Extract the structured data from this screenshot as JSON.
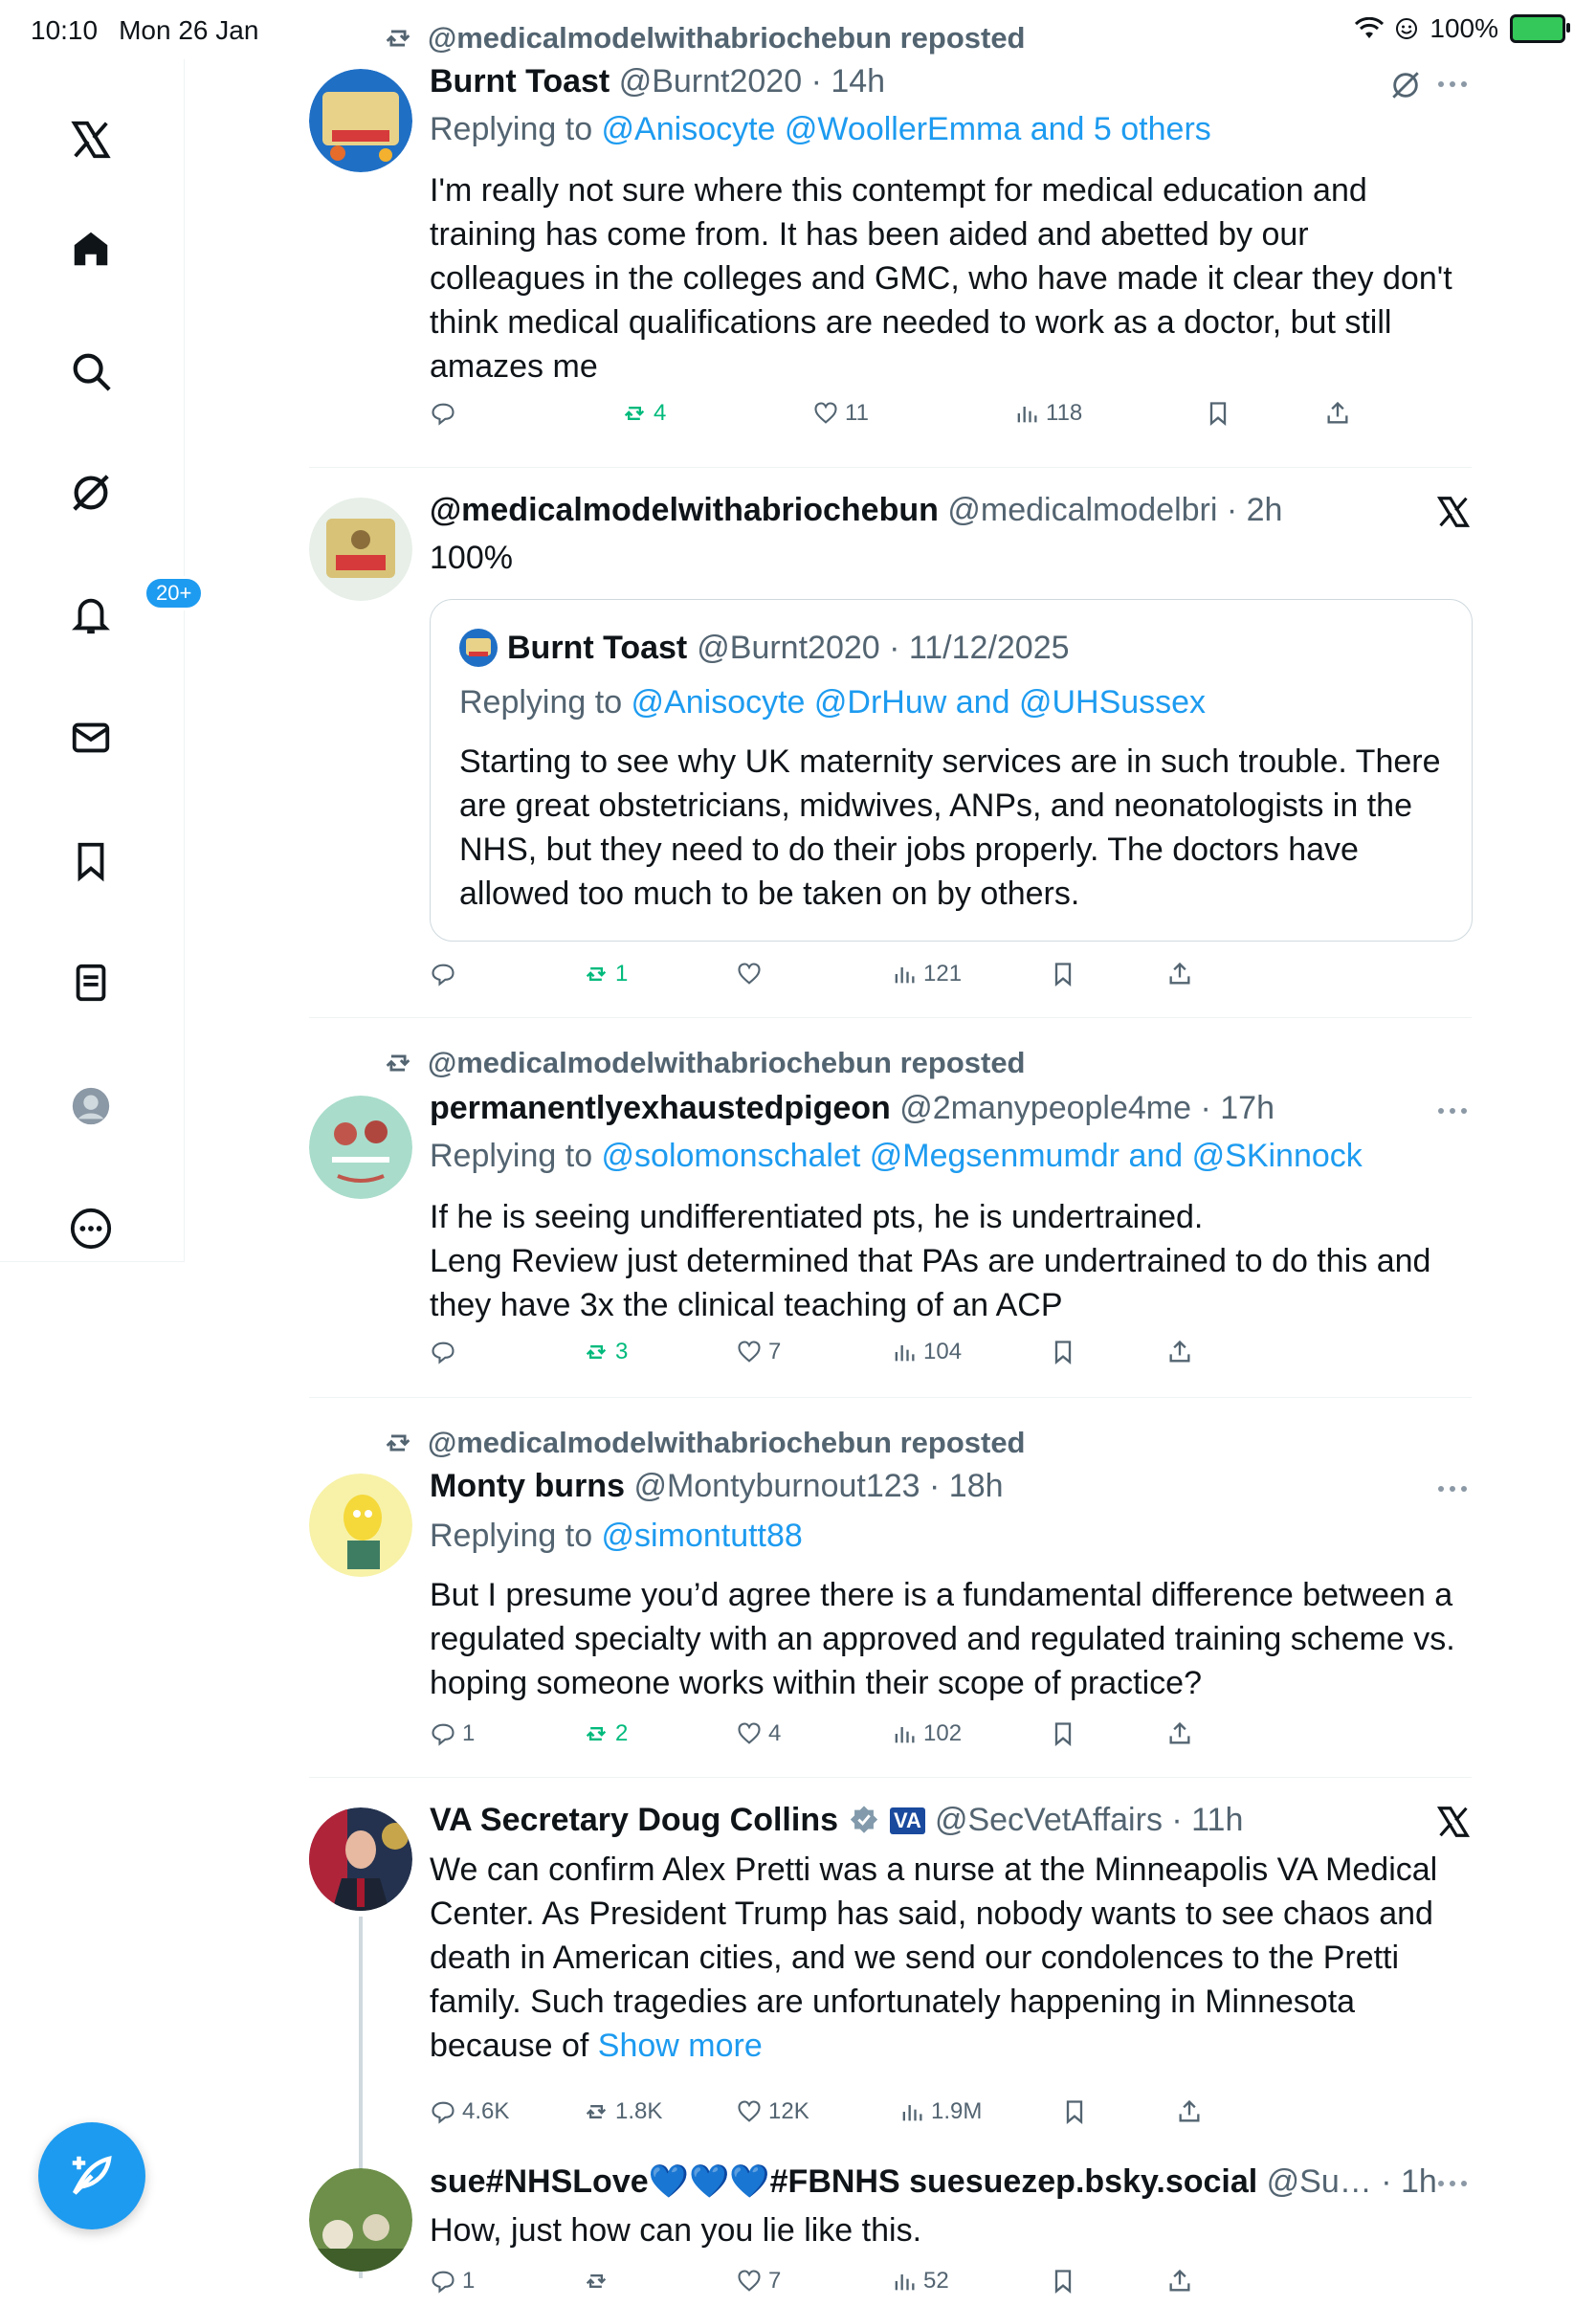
{
  "status_bar": {
    "time": "10:10",
    "date": "Mon 26 Jan",
    "battery": "100%"
  },
  "sidebar": {
    "notifications_badge": "20+"
  },
  "posts": [
    {
      "repost_label": "@medicalmodelwithabriochebun reposted",
      "name": "Burnt Toast",
      "handle": "@Burnt2020 · 14h",
      "reply_prefix": "Replying to ",
      "reply_targets": "@Anisocyte @WoollerEmma and 5 others",
      "text": "I'm really not sure where this contempt for medical education and training has come from. It has been aided and abetted by our colleagues in the colleges and GMC, who have made it clear they don't think medical qualifications are needed to work as a doctor, but still amazes me",
      "retweets": "4",
      "likes": "11",
      "views": "118"
    },
    {
      "name": "@medicalmodelwithabriochebun",
      "handle": "@medicalmodelbri · 2h",
      "text": "100%",
      "quote": {
        "name": "Burnt Toast",
        "handle": "@Burnt2020 · 11/12/2025",
        "reply_prefix": "Replying to ",
        "reply_targets": "@Anisocyte @DrHuw and @UHSussex",
        "text": "Starting to see why UK maternity services are in such trouble. There are great obstetricians, midwives, ANPs, and neonatologists in the NHS, but they need to do their jobs properly. The doctors have allowed too much to be taken on by others."
      },
      "retweets": "1",
      "views": "121"
    },
    {
      "repost_label": "@medicalmodelwithabriochebun reposted",
      "name": "permanentlyexhaustedpigeon",
      "handle": "@2manypeople4me · 17h",
      "reply_prefix": "Replying to ",
      "reply_targets": "@solomonschalet @Megsenmumdr and @SKinnock",
      "text_line1": "If he is seeing undifferentiated pts, he is undertrained.",
      "text_line2": "Leng Review just determined that PAs are undertrained to do this and they have 3x the clinical teaching of an ACP",
      "retweets": "3",
      "likes": "7",
      "views": "104"
    },
    {
      "repost_label": "@medicalmodelwithabriochebun reposted",
      "name": "Monty burns",
      "handle": "@Montyburnout123 · 18h",
      "reply_prefix": "Replying to ",
      "reply_targets": "@simontutt88",
      "text": "But I presume you’d agree there is a fundamental difference between a regulated specialty with an approved and regulated training scheme vs. hoping someone works within their scope of practice?",
      "replies": "1",
      "retweets": "2",
      "likes": "4",
      "views": "102"
    },
    {
      "name": "VA Secretary Doug Collins",
      "va_badge": "VA",
      "handle": "@SecVetAffairs · 11h",
      "text": "We can confirm Alex Pretti was a nurse at the Minneapolis VA Medical Center. As President Trump has said, nobody wants to see chaos and death in American cities, and we send our condolences to the Pretti family. Such tragedies are unfortunately happening in Minnesota because of ",
      "show_more": "Show more",
      "replies": "4.6K",
      "retweets": "1.8K",
      "likes": "12K",
      "views": "1.9M"
    },
    {
      "name": "sue#NHSLove💙💙💙#FBNHS suesuezep.bsky.social",
      "handle": "@Su… · 1h",
      "text": "How, just how can you lie like this.",
      "replies": "1",
      "likes": "7",
      "views": "52"
    }
  ],
  "colors": {
    "accent": "#1d9bf0",
    "retweet_green": "#00ba7c",
    "secondary": "#536471"
  }
}
